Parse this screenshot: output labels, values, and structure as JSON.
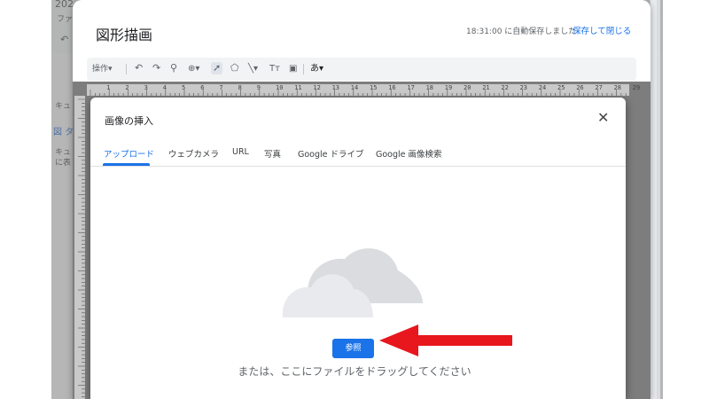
{
  "background_doc": {
    "title_fragment": "202",
    "menu_fragment": "ファ",
    "undo_icon": "undo-icon",
    "left_text_1": "キュ",
    "left_text_2": "図 タ",
    "left_text_3": "キュ",
    "left_text_4": "に表"
  },
  "drawing": {
    "title": "図形描画",
    "autosave_status": "18:31:00 に自動保存しました",
    "save_close_label": "保存して閉じる",
    "toolbar": {
      "actions_label": "操作▾",
      "undo_icon": "undo-icon",
      "redo_icon": "redo-icon",
      "paint_format_icon": "paint-format-icon",
      "zoom_icon": "zoom-icon",
      "select_icon": "select-cursor-icon",
      "shape_icon": "shape-icon",
      "line_icon": "line-icon",
      "textbox_icon": "text-box-icon",
      "image_icon": "image-icon",
      "input_tools_label": "あ▾"
    },
    "ruler_numbers": [
      "1",
      "2",
      "3",
      "4",
      "5",
      "6",
      "7",
      "8",
      "9",
      "10",
      "11",
      "12",
      "13",
      "14",
      "15",
      "16",
      "17",
      "18",
      "19",
      "20",
      "21",
      "22",
      "23",
      "24",
      "25",
      "26",
      "27",
      "28",
      "29"
    ]
  },
  "dialog": {
    "title": "画像の挿入",
    "close_icon": "close-icon",
    "tabs": [
      {
        "label": "アップロード",
        "active": true
      },
      {
        "label": "ウェブカメラ",
        "active": false
      },
      {
        "label": "URL",
        "active": false
      },
      {
        "label": "写真",
        "active": false
      },
      {
        "label": "Google ドライブ",
        "active": false
      },
      {
        "label": "Google 画像検索",
        "active": false
      }
    ],
    "upload_illustration": "cloud-upload-illustration",
    "browse_button": "参照",
    "drag_hint": "または、ここにファイルをドラッグしてください"
  },
  "annotation": {
    "arrow_icon": "red-arrow-icon",
    "arrow_color": "#e8161d"
  },
  "colors": {
    "accent": "#1a73e8",
    "overlay": "#7d7d7d"
  }
}
